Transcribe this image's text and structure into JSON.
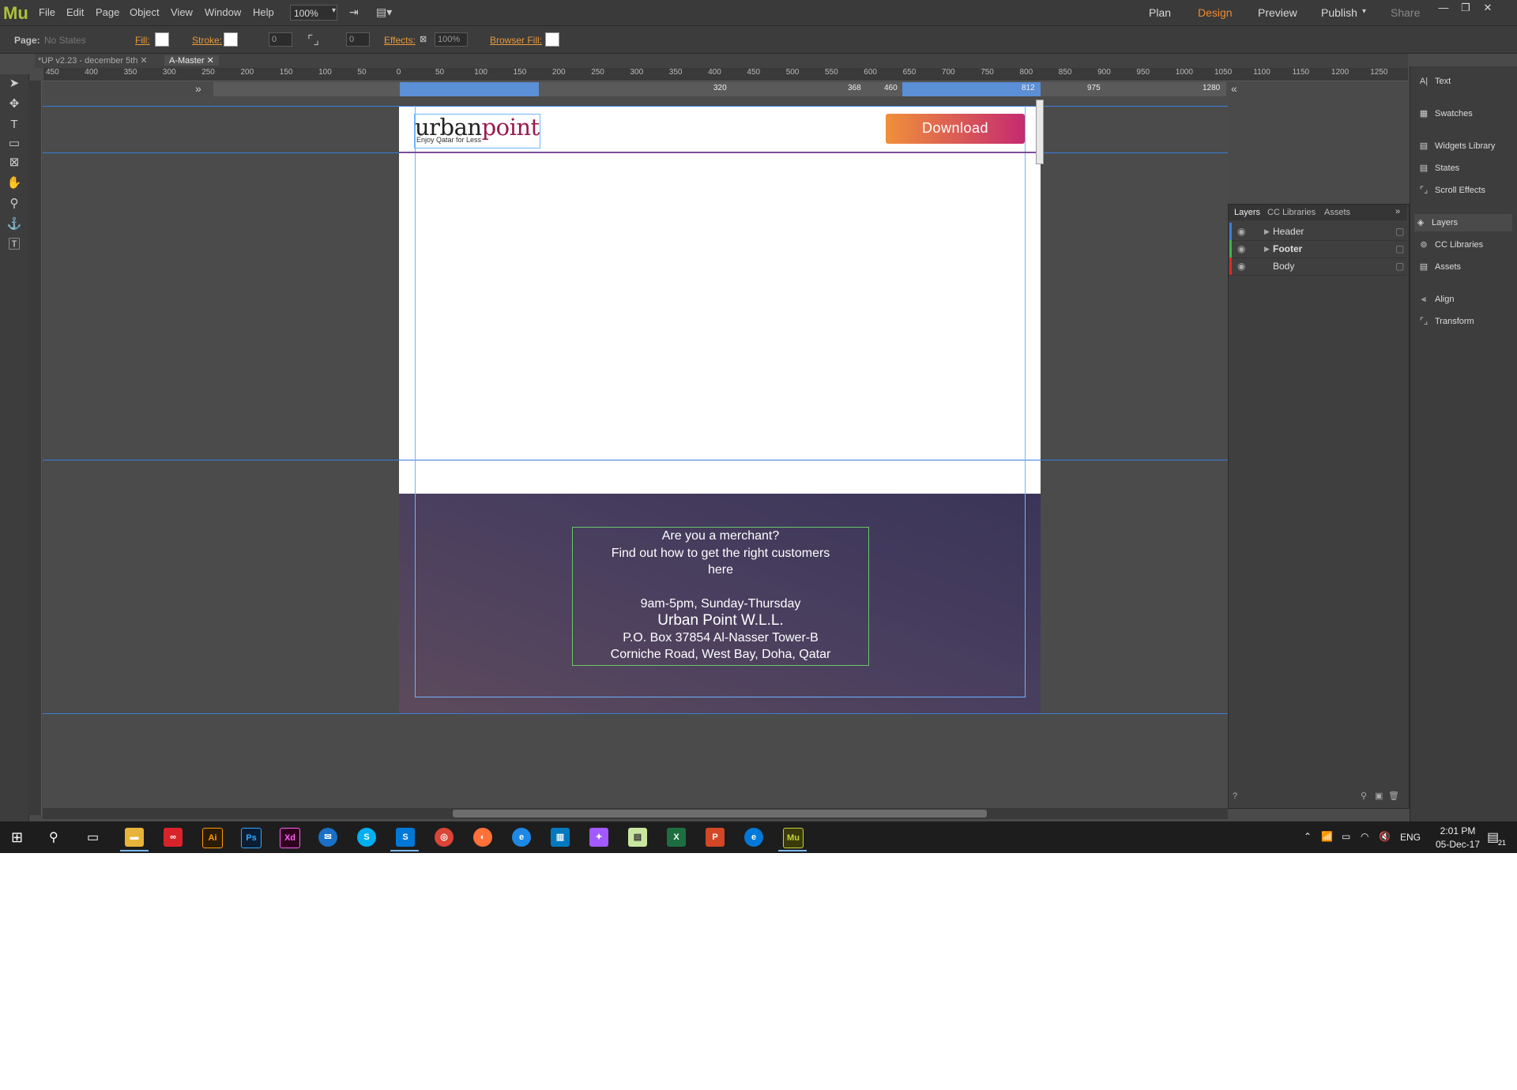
{
  "app": {
    "logo": "Mu",
    "menu": [
      "File",
      "Edit",
      "Page",
      "Object",
      "View",
      "Window",
      "Help"
    ],
    "zoom": "100%",
    "workspace_tabs": [
      "Plan",
      "Design",
      "Preview",
      "Publish",
      "Share"
    ],
    "active_workspace": "Design"
  },
  "control_bar": {
    "page_label": "Page:",
    "page_state": "No States",
    "fill_label": "Fill:",
    "stroke_label": "Stroke:",
    "stroke_value": "0",
    "corner_value": "0",
    "effects_label": "Effects:",
    "opacity": "100%",
    "browser_fill_label": "Browser Fill:"
  },
  "doc_tabs": [
    {
      "label": "*UP v2.23 - december 5th",
      "active": false
    },
    {
      "label": "A-Master",
      "active": true
    }
  ],
  "ruler": [
    "450",
    "400",
    "350",
    "300",
    "250",
    "200",
    "150",
    "100",
    "50",
    "0",
    "50",
    "100",
    "150",
    "200",
    "250",
    "300",
    "350",
    "400",
    "450",
    "500",
    "550",
    "600",
    "650",
    "700",
    "750",
    "800",
    "850",
    "900",
    "950",
    "1000",
    "1050",
    "1100",
    "1150",
    "1200",
    "1250"
  ],
  "breakpoints": {
    "center": "320",
    "markers": [
      "368",
      "460",
      "812",
      "975",
      "1280"
    ]
  },
  "canvas": {
    "logo_urban": "urban",
    "logo_point": "point",
    "logo_tagline": "Enjoy Qatar for Less",
    "download_button": "Download",
    "footer_lines": [
      "Are you a merchant?",
      "Find out how to get the right customers",
      "here",
      "",
      "9am-5pm, Sunday-Thursday",
      "Urban Point W.L.L.",
      "P.O. Box 37854 Al-Nasser Tower-B",
      "Corniche Road, West Bay, Doha, Qatar"
    ]
  },
  "layers_panel": {
    "tabs": [
      "Layers",
      "CC Libraries",
      "Assets"
    ],
    "layers": [
      {
        "name": "Header",
        "color": "#3b7dd8"
      },
      {
        "name": "Footer",
        "color": "#3cb34a"
      },
      {
        "name": "Body",
        "color": "#d82a2a"
      }
    ]
  },
  "dock": [
    "Text",
    "Swatches",
    "Widgets Library",
    "States",
    "Scroll Effects",
    "Layers",
    "CC Libraries",
    "Assets",
    "Align",
    "Transform"
  ],
  "taskbar": {
    "apps": [
      "Explorer",
      "Creative Cloud",
      "Ai",
      "Ps",
      "Xd",
      "Thunderbird",
      "Skype",
      "Skype Business",
      "Chrome",
      "Firefox",
      "IE",
      "Trello",
      "Figma",
      "Notepad",
      "Excel",
      "PowerPoint",
      "Edge",
      "Mu"
    ],
    "language": "ENG",
    "time": "2:01 PM",
    "date": "05-Dec-17",
    "notifications": "21"
  }
}
